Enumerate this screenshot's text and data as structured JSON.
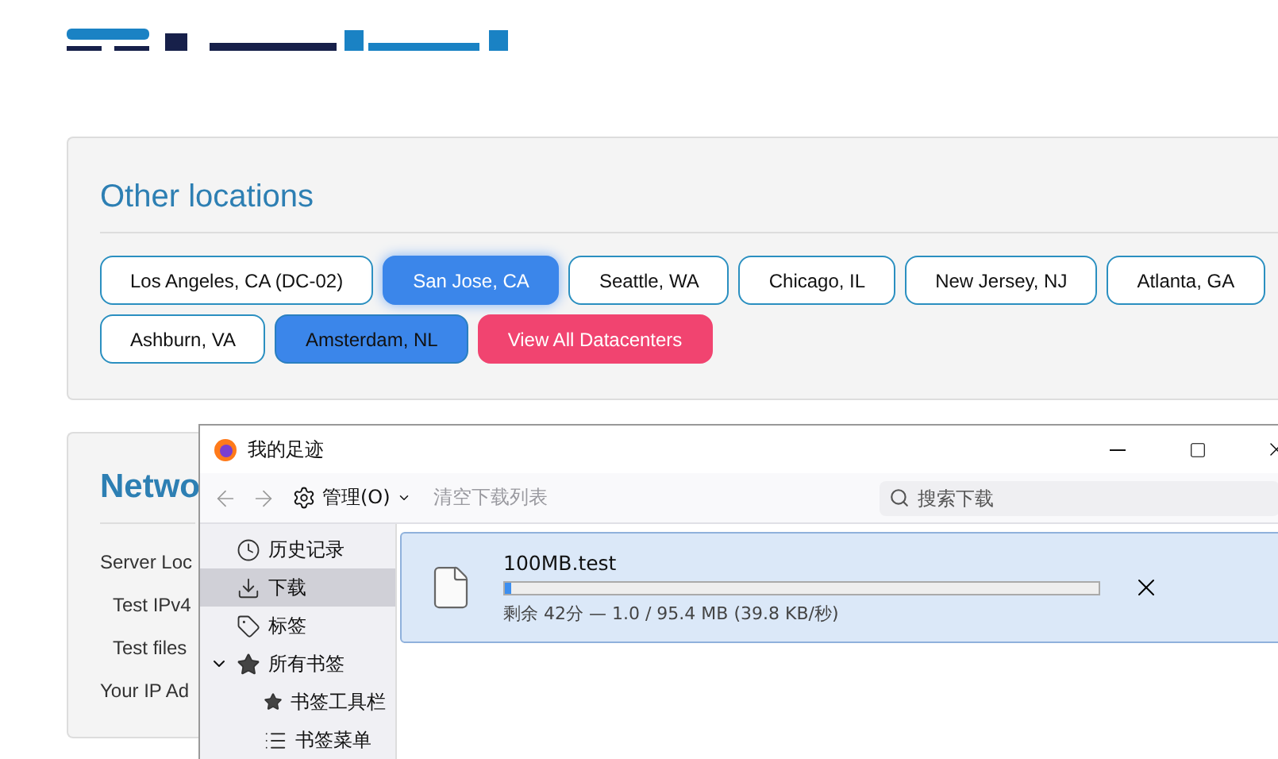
{
  "other_locations": {
    "title": "Other locations",
    "buttons": [
      {
        "kind": "location",
        "label": "Los Angeles, CA (DC-02)",
        "selected": false,
        "highlighted": false
      },
      {
        "kind": "location",
        "label": "San Jose, CA",
        "selected": true,
        "highlighted": false
      },
      {
        "kind": "location",
        "label": "Seattle, WA",
        "selected": false,
        "highlighted": false
      },
      {
        "kind": "location",
        "label": "Chicago, IL",
        "selected": false,
        "highlighted": false
      },
      {
        "kind": "location",
        "label": "New Jersey, NJ",
        "selected": false,
        "highlighted": false
      },
      {
        "kind": "location",
        "label": "Atlanta, GA",
        "selected": false,
        "highlighted": false
      },
      {
        "kind": "location",
        "label": "Ashburn, VA",
        "selected": false,
        "highlighted": false
      },
      {
        "kind": "location",
        "label": "Amsterdam, NL",
        "selected": false,
        "highlighted": true
      },
      {
        "kind": "view-all",
        "label": "View All Datacenters",
        "selected": false,
        "highlighted": false
      }
    ]
  },
  "network": {
    "title": "Netwo",
    "rows": [
      {
        "label": "Server Loc",
        "children": [
          {
            "label": "Test IPv4"
          },
          {
            "label": "Test files"
          }
        ]
      },
      {
        "label": "Your IP Ad"
      }
    ]
  },
  "library_window": {
    "title": "我的足迹",
    "toolbar": {
      "manage": "管理(O)",
      "clear": "清空下载列表",
      "clear_disabled": true,
      "search": {
        "placeholder": "搜索下载"
      }
    },
    "sidebar": [
      {
        "kind": "history",
        "label": "历史记录",
        "selected": false
      },
      {
        "kind": "downloads",
        "label": "下载",
        "selected": true
      },
      {
        "kind": "tags",
        "label": "标签",
        "selected": false
      },
      {
        "kind": "bookmarks",
        "label": "所有书签",
        "selected": false,
        "expanded": true,
        "children": [
          {
            "kind": "toolbar",
            "label": "书签工具栏",
            "selected": false
          },
          {
            "kind": "menu",
            "label": "书签菜单",
            "selected": false
          }
        ]
      }
    ],
    "downloads": [
      {
        "name": "100MB.test",
        "level": 0.01,
        "status": "剩余 42分 — 1.0 / 95.4 MB (39.8 KB/秒)"
      }
    ]
  }
}
